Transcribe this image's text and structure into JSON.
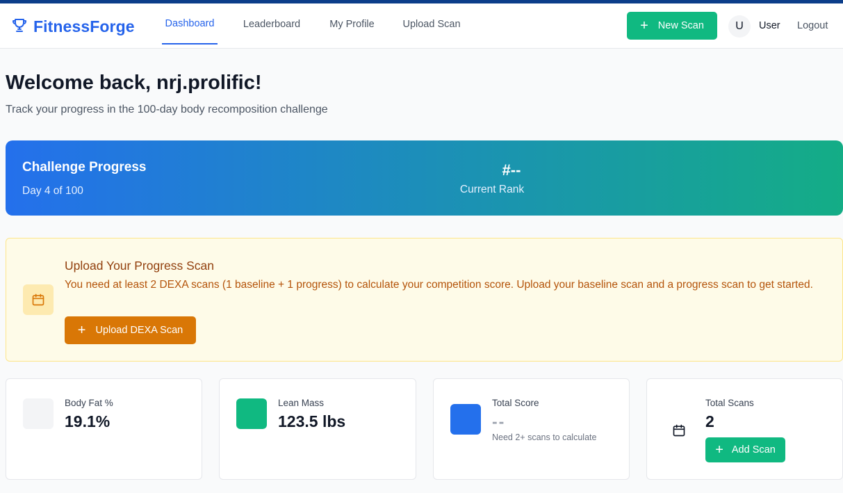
{
  "brand": {
    "name": "FitnessForge",
    "icon": "trophy-icon",
    "color": "#2563eb"
  },
  "nav": {
    "tabs": [
      {
        "label": "Dashboard",
        "active": true
      },
      {
        "label": "Leaderboard",
        "active": false
      },
      {
        "label": "My Profile",
        "active": false
      },
      {
        "label": "Upload Scan",
        "active": false
      }
    ],
    "new_scan_label": "New Scan",
    "avatar_initial": "U",
    "user_label": "User",
    "logout_label": "Logout"
  },
  "header": {
    "title": "Welcome back, nrj.prolific!",
    "subtitle": "Track your progress in the 100-day body recomposition challenge"
  },
  "challenge": {
    "title": "Challenge Progress",
    "day_text": "Day 4 of 100",
    "rank_value": "#--",
    "rank_label": "Current Rank",
    "gradient": [
      "#2470ec",
      "#14ad86"
    ]
  },
  "alert": {
    "icon": "calendar-icon",
    "title": "Upload Your Progress Scan",
    "message": "You need at least 2 DEXA scans (1 baseline + 1 progress) to calculate your competition score. Upload your baseline scan and a progress scan to get started.",
    "button_label": "Upload DEXA Scan"
  },
  "stats": [
    {
      "label": "Body Fat %",
      "value": "19.1%",
      "swatch_color": "#f3f4f6"
    },
    {
      "label": "Lean Mass",
      "value": "123.5 lbs",
      "swatch_color": "#10b981"
    },
    {
      "label": "Total Score",
      "value": "--",
      "note": "Need 2+ scans to calculate",
      "swatch_color": "#2470ec"
    },
    {
      "label": "Total Scans",
      "value": "2",
      "icon": "calendar-icon",
      "button_label": "Add Scan"
    }
  ],
  "colors": {
    "primary": "#2563eb",
    "success": "#10b981",
    "warning": "#d97706",
    "stripe": "#0c3e8a"
  }
}
